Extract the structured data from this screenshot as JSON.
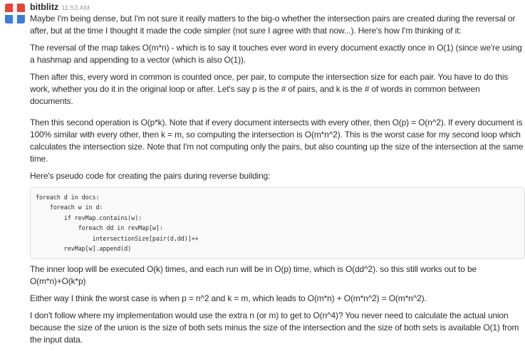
{
  "message": {
    "author": "bitblitz",
    "timestamp": "11:53 AM",
    "avatar_colors": [
      "#e0463a",
      "#3b7dd8",
      "#ffffff"
    ],
    "paragraphs_before_code": [
      "Maybe I'm being dense, but I'm not sure it really matters to the big-o whether the intersection pairs are created during the reversal or after, but at the time I thought it made the code simpler (not sure I agree with that now...). Here's how I'm thinking of it:",
      "The reversal of the map takes O(m*n) - which is to say it touches ever word in every document exactly once in O(1) (since we're using a hashmap and appending to a vector (which is also O(1)).",
      "Then after this, every word in common is counted once, per pair, to compute the intersection size for each pair. You have to do this work, whether you do it in the original loop or after. Let's say p is the # of pairs, and k is the # of words in common between documents.",
      "Then this second operation is O(p*k). Note that if every document intersects with every other, then O(p) = O(n^2). If every document is 100% similar with every other, then k = m, so computing the intersection is O(m*n^2). This is the worst case for my second loop which calculates the intersection size. Note that I'm not computing only the pairs, but also counting up the size of the intersection at the same time.",
      "Here's pseudo code for creating the pairs during reverse building:"
    ],
    "code_lines": [
      "foreach d in docs:",
      "    foreach w in d:",
      "        if revMap.contains(w):",
      "            foreach dd in revMap[w]:",
      "                intersectionSize[pair(d,dd)]++",
      "        revMap[w].append(d)"
    ],
    "paragraphs_after_code": [
      "The inner loop will be executed O(k) times, and each run will be in O(p) time, which is O(dd^2). so this still works out to be O(m*n)+O(k*p)",
      "Either way I think the worst case is when p = n^2 and k = m, which leads to O(m*n) + O(m*n^2) = O(m*n^2).",
      "I don't follow where my implementation would use the extra n (or m) to get to O(n^4)? You never need to calculate the actual union because the size of the union is the size of both sets minus the size of the intersection and the size of both sets is available O(1) from the input data."
    ]
  }
}
